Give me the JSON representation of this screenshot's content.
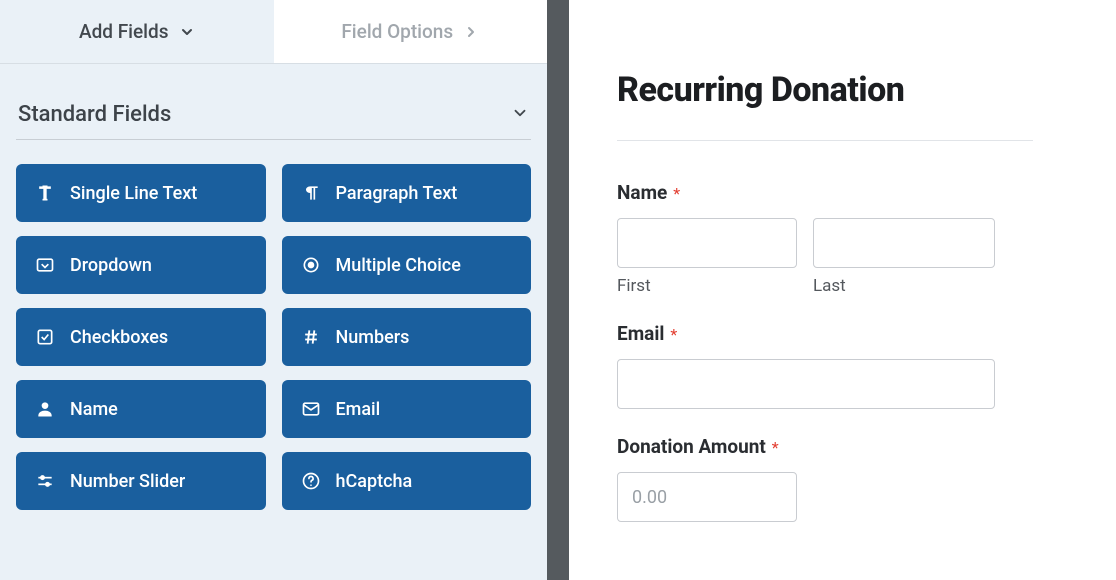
{
  "tabs": {
    "add_fields": "Add Fields",
    "field_options": "Field Options"
  },
  "section": {
    "title": "Standard Fields"
  },
  "fields": [
    {
      "icon": "text-cursor-icon",
      "label": "Single Line Text"
    },
    {
      "icon": "paragraph-icon",
      "label": "Paragraph Text"
    },
    {
      "icon": "dropdown-icon",
      "label": "Dropdown"
    },
    {
      "icon": "radio-icon",
      "label": "Multiple Choice"
    },
    {
      "icon": "checkbox-icon",
      "label": "Checkboxes"
    },
    {
      "icon": "hash-icon",
      "label": "Numbers"
    },
    {
      "icon": "person-icon",
      "label": "Name"
    },
    {
      "icon": "envelope-icon",
      "label": "Email"
    },
    {
      "icon": "sliders-icon",
      "label": "Number Slider"
    },
    {
      "icon": "question-icon",
      "label": "hCaptcha"
    }
  ],
  "form": {
    "title": "Recurring Donation",
    "name_label": "Name",
    "first_sublabel": "First",
    "last_sublabel": "Last",
    "email_label": "Email",
    "donation_label": "Donation Amount",
    "donation_placeholder": "0.00",
    "required_marker": "*"
  }
}
